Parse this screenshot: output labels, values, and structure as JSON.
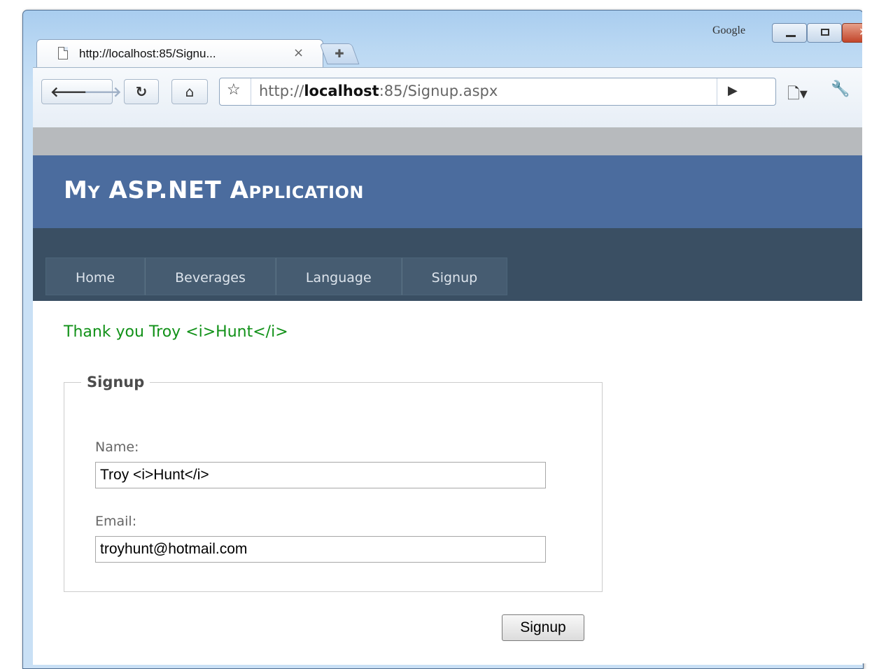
{
  "browser": {
    "frame_label": "Google",
    "tab": {
      "title": "http://localhost:85/Signu...",
      "close_glyph": "×"
    },
    "new_tab_glyph": "✚",
    "url": {
      "scheme": "http://",
      "host": "localhost",
      "rest": ":85/Signup.aspx"
    }
  },
  "page": {
    "app_title": "My ASP.NET Application",
    "menu": [
      {
        "label": "Home"
      },
      {
        "label": "Beverages"
      },
      {
        "label": "Language"
      },
      {
        "label": "Signup"
      }
    ],
    "thanks_message": "Thank you Troy <i>Hunt</i>",
    "form": {
      "legend": "Signup",
      "name_label": "Name:",
      "name_value": "Troy <i>Hunt</i>",
      "email_label": "Email:",
      "email_value": "troyhunt@hotmail.com",
      "submit_label": "Signup"
    }
  },
  "colors": {
    "header_bg": "#4b6c9e",
    "menubar_bg": "#3a4f63",
    "thanks_text": "#119118"
  },
  "icons": [
    "page-icon",
    "close-icon",
    "new-tab-icon",
    "back-icon",
    "forward-icon",
    "reload-icon",
    "home-icon",
    "star-icon",
    "go-icon",
    "page-menu-icon",
    "wrench-icon",
    "minimize-icon",
    "maximize-icon",
    "window-close-icon"
  ]
}
